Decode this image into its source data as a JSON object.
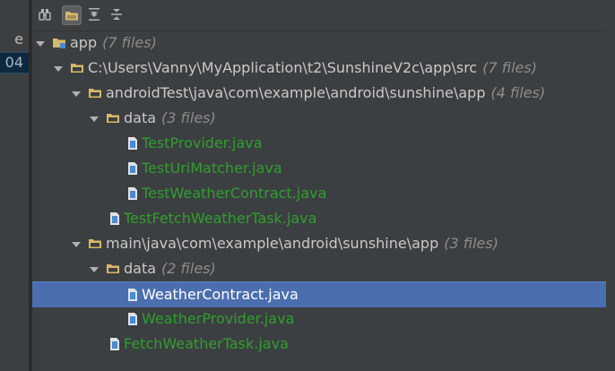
{
  "left_panel": {
    "cells": [
      {
        "text": "e",
        "selected": false
      },
      {
        "text": "04",
        "selected": true
      }
    ]
  },
  "toolbar": {
    "buttons": [
      {
        "name": "jump-to-source-button",
        "icon": "binoculars-icon",
        "active": false
      },
      {
        "name": "group-by-directory-button",
        "icon": "folder-icon",
        "active": true
      },
      {
        "name": "expand-all-button",
        "icon": "expand-all-icon",
        "active": false
      },
      {
        "name": "collapse-all-button",
        "icon": "collapse-all-icon",
        "active": false
      }
    ]
  },
  "tree": {
    "app": {
      "label": "app",
      "count": "(7 files)"
    },
    "src": {
      "label": "C:\\Users\\Vanny\\MyApplication\\t2\\SunshineV2c\\app\\src",
      "count": "(7 files)"
    },
    "android_test": {
      "label": "androidTest\\java\\com\\example\\android\\sunshine\\app",
      "count": "(4 files)"
    },
    "test_data": {
      "label": "data",
      "count": "(3 files)"
    },
    "test_provider": {
      "label": "TestProvider.java"
    },
    "test_uri_matcher": {
      "label": "TestUriMatcher.java"
    },
    "test_weather_contract": {
      "label": "TestWeatherContract.java"
    },
    "test_fetch_weather_task": {
      "label": "TestFetchWeatherTask.java"
    },
    "main": {
      "label": "main\\java\\com\\example\\android\\sunshine\\app",
      "count": "(3 files)"
    },
    "main_data": {
      "label": "data",
      "count": "(2 files)"
    },
    "weather_contract": {
      "label": "WeatherContract.java"
    },
    "weather_provider": {
      "label": "WeatherProvider.java"
    },
    "fetch_weather_task": {
      "label": "FetchWeatherTask.java"
    }
  },
  "colors": {
    "background": "#3c3f41",
    "selection": "#4b6eaf",
    "file_modified": "#2f9e2f",
    "folder": "#d6b869",
    "count_text": "#8c8c8c"
  }
}
